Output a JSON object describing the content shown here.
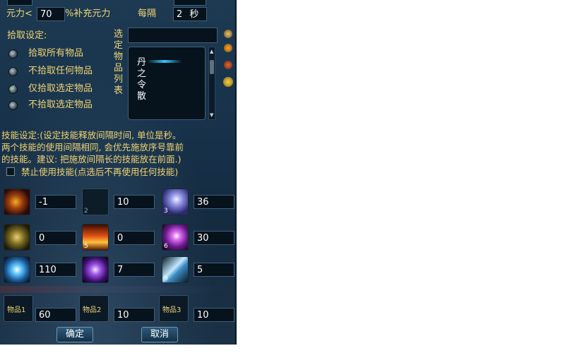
{
  "top": {
    "mana_label": "元力<",
    "mana_value": "70",
    "mana_suffix": "%补充元力",
    "every_label": "每隔",
    "every_value": "2",
    "every_unit": "秒"
  },
  "pickup": {
    "title": "拾取设定:",
    "options": [
      "拾取所有物品",
      "不拾取任何物品",
      "仅拾取选定物品",
      "不拾取选定物品"
    ],
    "selected_index": 2,
    "list_label": "选定物品列表",
    "list_items": [
      "丹",
      "之",
      "令",
      "散"
    ]
  },
  "skill": {
    "desc_lines": [
      "技能设定:(设定技能释放间隔时间, 单位是秒。",
      "两个技能的使用间隔相同, 会优先施放序号靠前",
      "的技能。建议: 把施放间隔长的技能放在前面.)"
    ],
    "disable_label": "禁止使用技能(点选后不再使用任何技能)",
    "slots": [
      {
        "index": "",
        "value": "-1",
        "icon": "serpent-skill-icon"
      },
      {
        "index": "2",
        "value": "10",
        "icon": "empty-skill-icon"
      },
      {
        "index": "3",
        "value": "36",
        "icon": "mage-skill-icon"
      },
      {
        "index": "",
        "value": "0",
        "icon": "ring-skill-icon"
      },
      {
        "index": "5",
        "value": "0",
        "icon": "fire-skill-icon"
      },
      {
        "index": "6",
        "value": "30",
        "icon": "burst-skill-icon"
      },
      {
        "index": "",
        "value": "110",
        "icon": "frost-skill-icon"
      },
      {
        "index": "",
        "value": "7",
        "icon": "orb-skill-icon"
      },
      {
        "index": "9",
        "value": "5",
        "icon": "ice-skill-icon"
      }
    ]
  },
  "items": [
    {
      "label": "物品1",
      "value": "60"
    },
    {
      "label": "物品2",
      "value": "10"
    },
    {
      "label": "物品3",
      "value": "10"
    }
  ],
  "buttons": {
    "ok": "确定",
    "cancel": "取消"
  },
  "colors": {
    "label_gold": "#f2d472",
    "panel_blue": "#17324a",
    "field_dark": "#06121c"
  }
}
